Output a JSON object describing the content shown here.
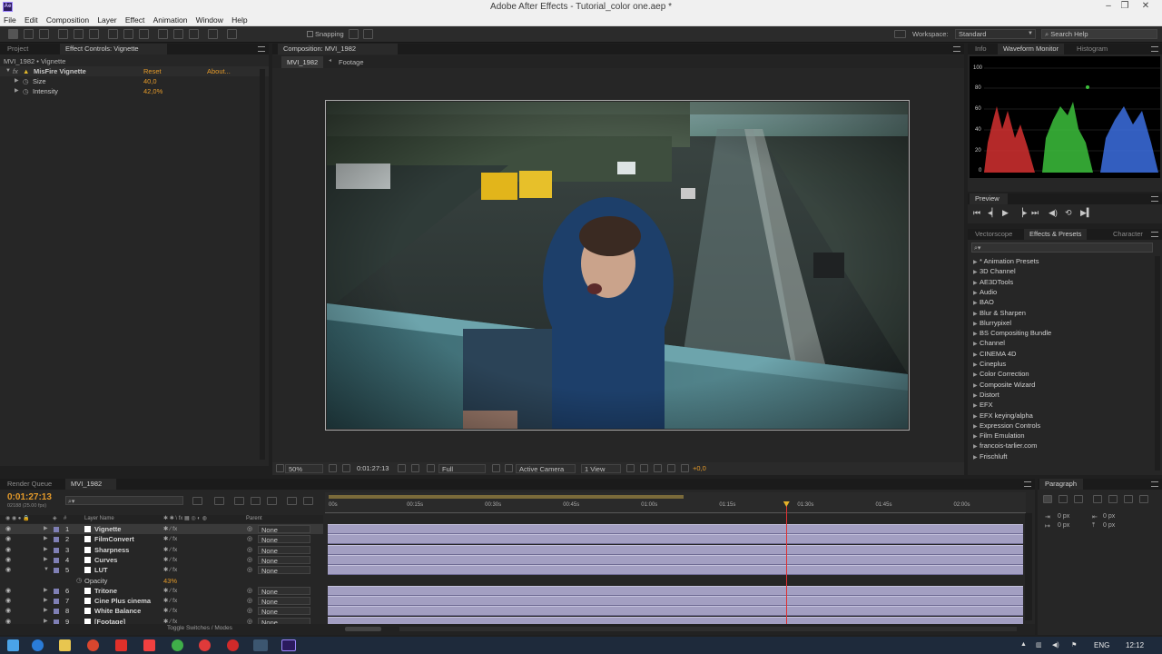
{
  "window": {
    "title": "Adobe After Effects - Tutorial_color one.aep *",
    "app_icon": "Ae"
  },
  "menu": [
    "File",
    "Edit",
    "Composition",
    "Layer",
    "Effect",
    "Animation",
    "Window",
    "Help"
  ],
  "toolbar": {
    "snapping_label": "Snapping",
    "workspace_label": "Workspace:",
    "workspace_value": "Standard",
    "search_placeholder": "Search Help"
  },
  "left_panel": {
    "tabs": [
      "Project",
      "Effect Controls: Vignette"
    ],
    "breadcrumb": "MVI_1982 • Vignette",
    "effect_name": "MisFire Vignette",
    "reset_label": "Reset",
    "about_label": "About...",
    "params": [
      {
        "name": "Size",
        "value": "40,0"
      },
      {
        "name": "Intensity",
        "value": "42,0%"
      }
    ]
  },
  "comp_panel": {
    "tab": "Composition: MVI_1982",
    "breadcrumbs": [
      "MVI_1982",
      "Footage"
    ],
    "footer": {
      "zoom": "50%",
      "timecode": "0:01:27:13",
      "resolution": "Full",
      "camera": "Active Camera",
      "view": "1 View",
      "exposure": "+0,0"
    }
  },
  "info_panel": {
    "tabs": [
      "Info",
      "Waveform Monitor",
      "Histogram"
    ],
    "scale": [
      "100",
      "80",
      "60",
      "40",
      "20",
      "0"
    ]
  },
  "preview_panel": {
    "tab": "Preview"
  },
  "effects_panel": {
    "tabs": [
      "Vectorscope",
      "Effects & Presets",
      "Character"
    ],
    "search_placeholder": "",
    "items": [
      "* Animation Presets",
      "3D Channel",
      "AE3DTools",
      "Audio",
      "BAO",
      "Blur & Sharpen",
      "Blurrypixel",
      "BS Compositing Bundle",
      "Channel",
      "CINEMA 4D",
      "Cineplus",
      "Color Correction",
      "Composite Wizard",
      "Distort",
      "EFX",
      "EFX keying/alpha",
      "Expression Controls",
      "Film Emulation",
      "francois-tarlier.com",
      "Frischluft"
    ]
  },
  "timeline": {
    "tabs": [
      "Render Queue",
      "MVI_1982"
    ],
    "timecode": "0:01:27:13",
    "timecode_sub": "02188 (25.00 fps)",
    "col_layer_name": "Layer Name",
    "col_parent": "Parent",
    "ruler": [
      "00s",
      "00:15s",
      "00:30s",
      "00:45s",
      "01:00s",
      "01:15s",
      "01:30s",
      "01:45s",
      "02:00s"
    ],
    "playhead_fraction": 0.659,
    "work_area_end_fraction": 0.51,
    "layers": [
      {
        "num": "1",
        "name": "Vignette",
        "parent": "None"
      },
      {
        "num": "2",
        "name": "FilmConvert",
        "parent": "None"
      },
      {
        "num": "3",
        "name": "Sharpness",
        "parent": "None"
      },
      {
        "num": "4",
        "name": "Curves",
        "parent": "None"
      },
      {
        "num": "5",
        "name": "LUT",
        "parent": "None"
      },
      {
        "num": "",
        "name": "Opacity",
        "parent": "",
        "value": "43%"
      },
      {
        "num": "6",
        "name": "Tritone",
        "parent": "None"
      },
      {
        "num": "7",
        "name": "Cine Plus cinema",
        "parent": "None"
      },
      {
        "num": "8",
        "name": "White Balance",
        "parent": "None"
      },
      {
        "num": "9",
        "name": "[Footage]",
        "parent": "None"
      }
    ],
    "footer": "Toggle Switches / Modes"
  },
  "paragraph_panel": {
    "tab": "Paragraph",
    "fields": [
      "0 px",
      "0 px",
      "0 px",
      "0 px"
    ]
  },
  "taskbar": {
    "lang": "ENG",
    "time": "12:12"
  }
}
